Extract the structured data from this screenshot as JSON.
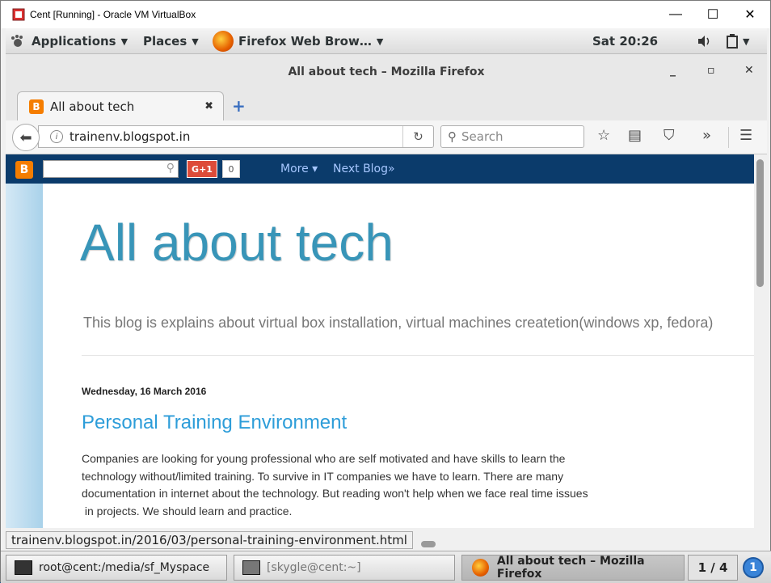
{
  "vbox": {
    "title": "Cent [Running] - Oracle VM VirtualBox",
    "min": "—",
    "max": "☐",
    "close": "✕"
  },
  "panel": {
    "applications": "Applications",
    "places": "Places",
    "app_button": "Firefox Web Brow…",
    "clock": "Sat 20:26"
  },
  "firefox": {
    "window_title": "All about tech – Mozilla Firefox",
    "tab_label": "All about tech",
    "url": "trainenv.blogspot.in",
    "search_placeholder": "Search"
  },
  "blogger": {
    "gplus": "G+1",
    "gcount": "0",
    "more": "More ▾",
    "next_blog": "Next Blog»"
  },
  "blog": {
    "title": "All about tech",
    "description": "This blog is explains about virtual box installation, virtual machines createtion(windows xp, fedora)",
    "date": "Wednesday, 16 March 2016",
    "post_title": "Personal Training Environment",
    "post_lines": [
      "Companies are looking for young professional who are self motivated and have skills to learn the",
      "technology without/limited training. To survive in IT companies we have to learn. There are many",
      "documentation in internet about the technology. But reading won't help when we face real time issues",
      " in projects. We should learn and practice."
    ]
  },
  "status_link": "trainenv.blogspot.in/2016/03/personal-training-environment.html",
  "taskbar": {
    "task1": "root@cent:/media/sf_Myspace",
    "task2": "[skygle@cent:~]",
    "task3": "All about tech – Mozilla Firefox",
    "pager": "1 / 4",
    "notif": "1"
  },
  "colors": {
    "blogger_bar": "#0b3b6b",
    "title_blue": "#3895b8",
    "post_link": "#2d9dd9"
  }
}
